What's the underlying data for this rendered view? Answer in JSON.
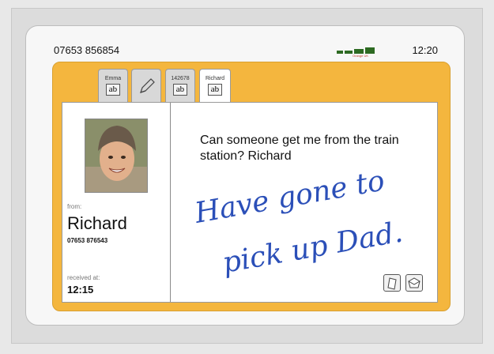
{
  "status": {
    "phone_number": "07653 856854",
    "operator": "Orange UK",
    "time": "12:20"
  },
  "tabs": [
    {
      "label": "Emma",
      "icon": "ab",
      "active": false
    },
    {
      "label": "",
      "icon": "pen-icon",
      "active": false
    },
    {
      "label": "142678",
      "icon": "ab",
      "active": false
    },
    {
      "label": "Richard",
      "icon": "ab",
      "active": true
    }
  ],
  "sender": {
    "from_label": "from:",
    "name": "Richard",
    "number": "07653 876543",
    "received_label": "received at:",
    "received_time": "12:15"
  },
  "message": {
    "text": "Can someone get me from the train station? Richard",
    "reply_line1": "Have gone to",
    "reply_line2": "pick up Dad."
  },
  "actions": [
    {
      "name": "clear-note-button",
      "icon": "page-icon"
    },
    {
      "name": "send-reply-button",
      "icon": "envelope-icon"
    }
  ],
  "colors": {
    "panel": "#f4b63e",
    "ink": "#2b4fb8",
    "signal": "#2d6a22"
  }
}
